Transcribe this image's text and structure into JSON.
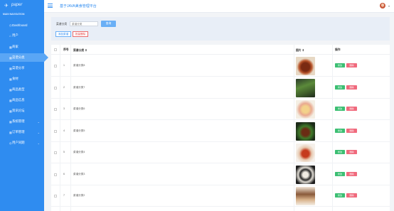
{
  "sidebar": {
    "logo_text": "paper",
    "nav_title": "MAIN NAVIGATION",
    "items": [
      {
        "label": "Dashboard",
        "icon": "clock-icon",
        "glyph": "◷"
      },
      {
        "label": "用户",
        "icon": "home-icon",
        "glyph": "⌂"
      },
      {
        "label": "商家",
        "icon": "grid-icon",
        "glyph": "▦"
      },
      {
        "label": "菜谱分类",
        "icon": "grid-icon",
        "glyph": "▦",
        "active": true
      },
      {
        "label": "菜谱分享",
        "icon": "grid-icon",
        "glyph": "▦"
      },
      {
        "label": "食材",
        "icon": "grid-icon",
        "glyph": "▦"
      },
      {
        "label": "商品类型",
        "icon": "grid-icon",
        "glyph": "▦"
      },
      {
        "label": "商品信息",
        "icon": "grid-icon",
        "glyph": "▦"
      },
      {
        "label": "资讯论坛",
        "icon": "grid-icon",
        "glyph": "▦"
      },
      {
        "label": "系统管理",
        "icon": "grid-icon",
        "glyph": "▦",
        "chevron": "⌄"
      },
      {
        "label": "订单管理",
        "icon": "grid-icon",
        "glyph": "▦",
        "chevron": "⌄"
      },
      {
        "label": "用户同期",
        "icon": "cycle-icon",
        "glyph": "◎",
        "chevron": "⌄"
      }
    ]
  },
  "header": {
    "title": "基于JAVA美食管理平台"
  },
  "search": {
    "label": "菜谱分类",
    "placeholder": "菜谱分类",
    "button": "查询",
    "add_button": "添加菜谱",
    "delete_button": "批量删除"
  },
  "table": {
    "columns": [
      "序号",
      "菜谱分类 ⇕",
      "图片 ⇕",
      "操作"
    ],
    "rows": [
      {
        "num": "1",
        "name": "菜谱分类8",
        "image": "braised-pork-photo"
      },
      {
        "num": "2",
        "name": "菜谱分类7",
        "image": "green-rolls-photo"
      },
      {
        "num": "3",
        "name": "菜谱分类6",
        "image": "salad-photo"
      },
      {
        "num": "4",
        "name": "菜谱分类5",
        "image": "chicken-dish-photo"
      },
      {
        "num": "5",
        "name": "菜谱分类4",
        "image": "spicy-fish-photo"
      },
      {
        "num": "6",
        "name": "菜谱分类3",
        "image": "dumplings-photo"
      },
      {
        "num": "7",
        "name": "菜谱分类2",
        "image": "dessert-drink-photo"
      }
    ],
    "edit_label": "修改",
    "delete_label": "删除"
  },
  "colors": {
    "sidebar": "#2f8cf0",
    "edit": "#3cbf73",
    "delete": "#f06a7d"
  }
}
